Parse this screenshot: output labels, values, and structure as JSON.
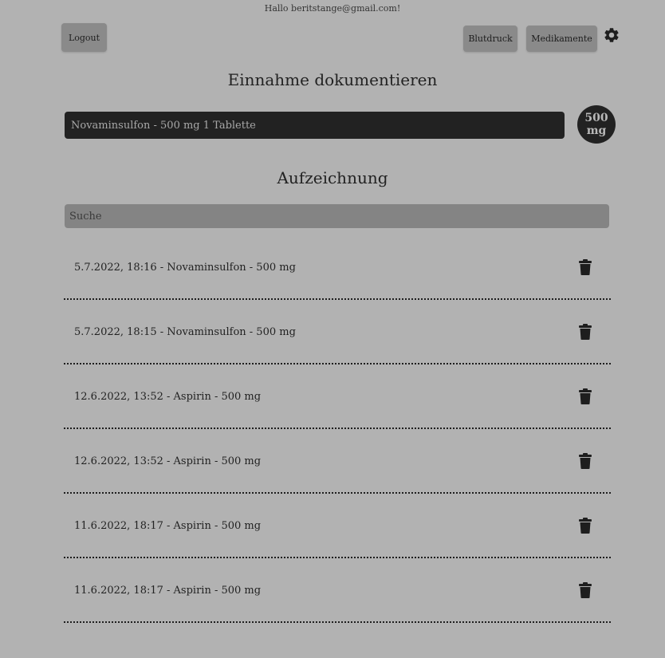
{
  "header": {
    "greeting": "Hallo beritstange@gmail.com!",
    "logout_label": "Logout",
    "blutdruck_label": "Blutdruck",
    "medikamente_label": "Medikamente",
    "settings_icon": "gear-icon"
  },
  "intake": {
    "title": "Einnahme dokumentieren",
    "selected_medication": "Novaminsulfon - 500 mg 1 Tablette",
    "dose_value": "500",
    "dose_unit": "mg"
  },
  "records": {
    "title": "Aufzeichnung",
    "search_placeholder": "Suche",
    "delete_icon": "trash-icon",
    "items": [
      {
        "label": "5.7.2022, 18:16 - Novaminsulfon - 500 mg"
      },
      {
        "label": "5.7.2022, 18:15 - Novaminsulfon - 500 mg"
      },
      {
        "label": "12.6.2022, 13:52 - Aspirin - 500 mg"
      },
      {
        "label": "12.6.2022, 13:52 - Aspirin - 500 mg"
      },
      {
        "label": "11.6.2022, 18:17 - Aspirin - 500 mg"
      },
      {
        "label": "11.6.2022, 18:17 - Aspirin - 500 mg"
      }
    ]
  },
  "colors": {
    "background": "#b2b2b2",
    "button": "#8a8a8a",
    "dark": "#222222",
    "search": "#848484"
  }
}
